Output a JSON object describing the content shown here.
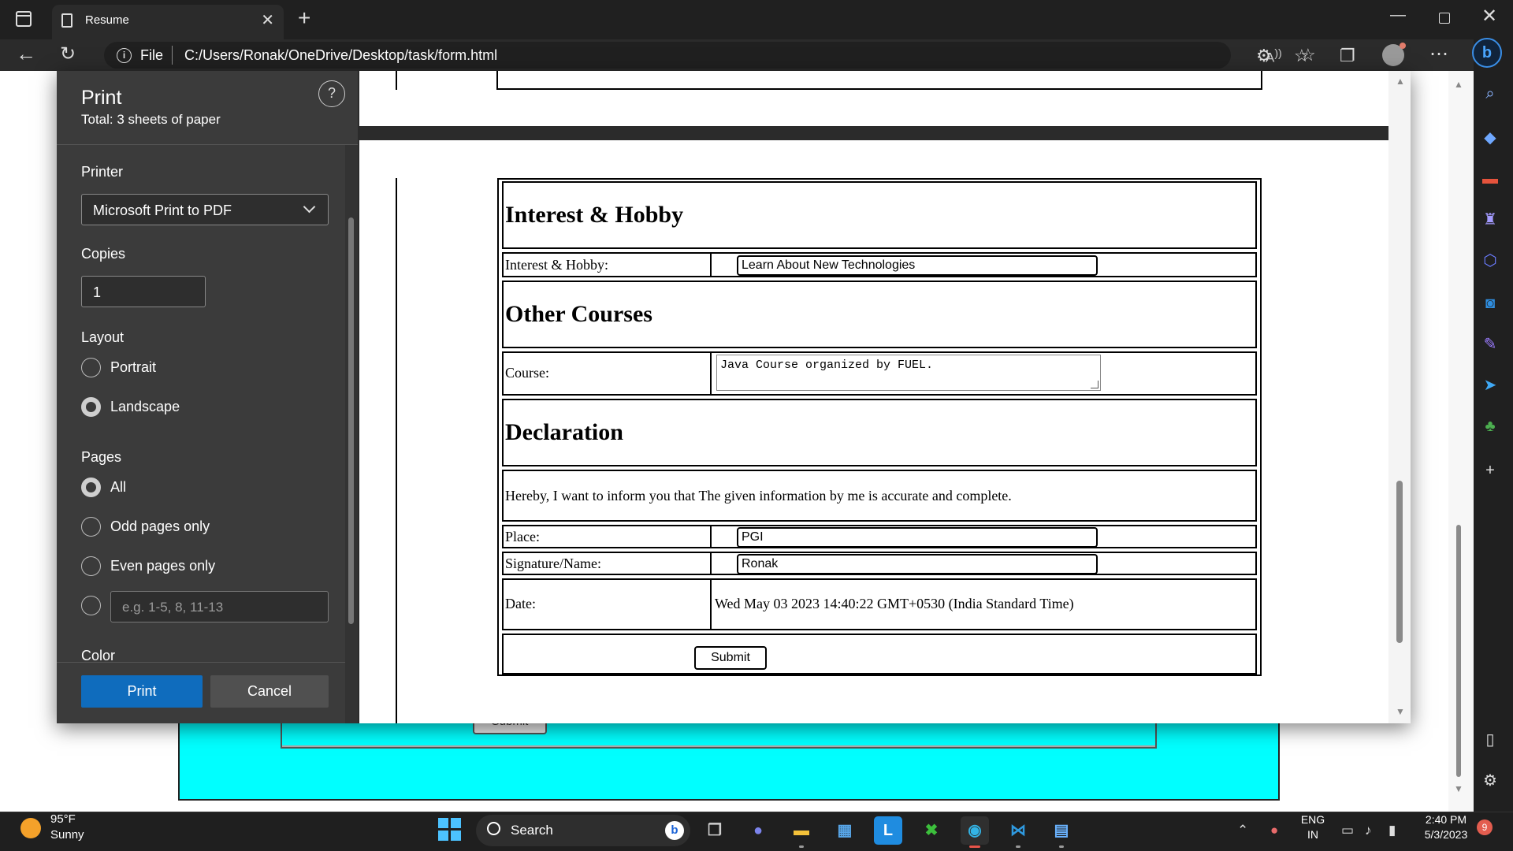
{
  "browser": {
    "tab_title": "Resume",
    "url_scheme": "File",
    "url": "C:/Users/Ronak/OneDrive/Desktop/task/form.html"
  },
  "print": {
    "title": "Print",
    "total": "Total: 3 sheets of paper",
    "help": "?",
    "printer_label": "Printer",
    "printer_value": "Microsoft Print to PDF",
    "copies_label": "Copies",
    "copies_value": "1",
    "layout_label": "Layout",
    "layout_options": [
      "Portrait",
      "Landscape"
    ],
    "layout_selected": "Landscape",
    "pages_label": "Pages",
    "pages_options": [
      "All",
      "Odd pages only",
      "Even pages only"
    ],
    "pages_selected": "All",
    "pages_custom_placeholder": "e.g. 1-5, 8, 11-13",
    "color_label": "Color",
    "print_button": "Print",
    "cancel_button": "Cancel"
  },
  "resume": {
    "interest_heading": "Interest & Hobby",
    "interest_label": "Interest & Hobby:",
    "interest_value": "Learn About New Technologies",
    "courses_heading": "Other Courses",
    "course_label": "Course:",
    "course_value": "Java Course organized by FUEL.",
    "declaration_heading": "Declaration",
    "declaration_text": "Hereby, I want to inform you that The given information by me is accurate and complete.",
    "place_label": "Place:",
    "place_value": "PGI",
    "signature_label": "Signature/Name:",
    "signature_value": "Ronak",
    "date_label": "Date:",
    "date_value": "Wed May 03 2023 14:40:22 GMT+0530 (India Standard Time)",
    "submit_label": "Submit"
  },
  "background_page": {
    "submit_label": "Submit",
    "cyan_color": "#00ffff"
  },
  "taskbar": {
    "weather_temp": "95°F",
    "weather_condition": "Sunny",
    "search_label": "Search",
    "lang_line1": "ENG",
    "lang_line2": "IN",
    "time": "2:40 PM",
    "date": "5/3/2023",
    "notification_count": "9"
  }
}
